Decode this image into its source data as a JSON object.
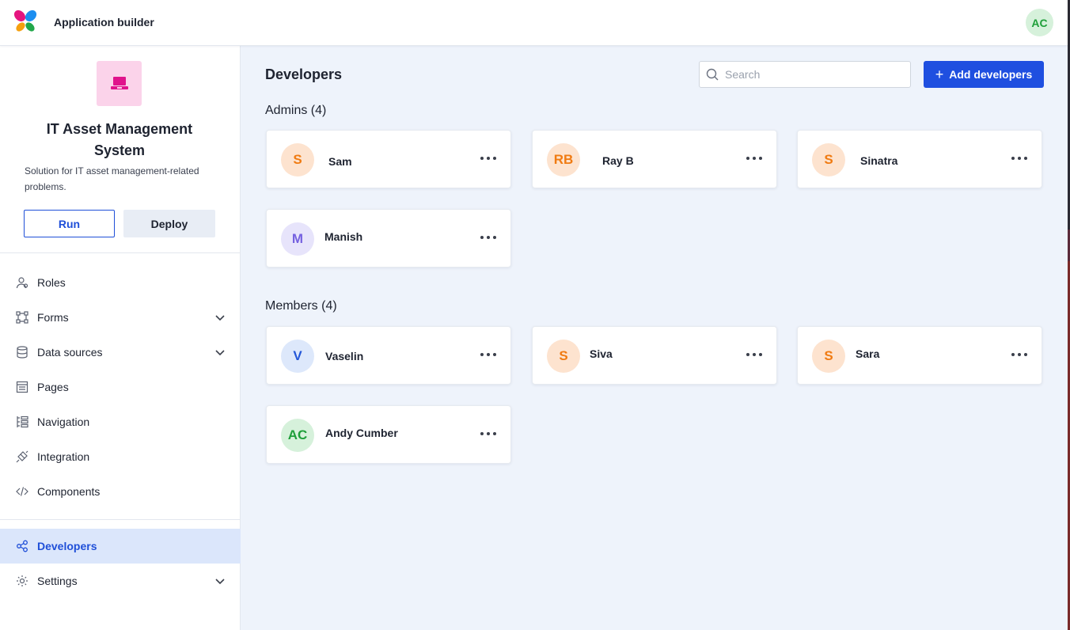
{
  "header": {
    "app_title": "Application builder",
    "user_initials": "AC"
  },
  "sidebar": {
    "app": {
      "name": "IT Asset Management System",
      "description": "Solution for IT asset management-related problems.",
      "icon": "laptop-icon",
      "icon_color": "#e0138c"
    },
    "run_label": "Run",
    "deploy_label": "Deploy",
    "items": [
      {
        "label": "Roles",
        "icon": "roles-icon",
        "expandable": false
      },
      {
        "label": "Forms",
        "icon": "forms-icon",
        "expandable": true
      },
      {
        "label": "Data sources",
        "icon": "database-icon",
        "expandable": true
      },
      {
        "label": "Pages",
        "icon": "pages-icon",
        "expandable": false
      },
      {
        "label": "Navigation",
        "icon": "navigation-icon",
        "expandable": false
      },
      {
        "label": "Integration",
        "icon": "integration-icon",
        "expandable": false
      },
      {
        "label": "Components",
        "icon": "code-icon",
        "expandable": false
      }
    ],
    "bottom_items": [
      {
        "label": "Developers",
        "icon": "share-icon",
        "active": true,
        "expandable": false
      },
      {
        "label": "Settings",
        "icon": "gear-icon",
        "active": false,
        "expandable": true
      }
    ]
  },
  "main": {
    "title": "Developers",
    "search_placeholder": "Search",
    "search_value": "",
    "add_button_label": "Add developers",
    "admins": {
      "title": "Admins (4)",
      "people": [
        {
          "initials": "S",
          "name": "Sam",
          "color": "orange"
        },
        {
          "initials": "RB",
          "name": "Ray B",
          "color": "orange"
        },
        {
          "initials": "S",
          "name": "Sinatra",
          "color": "orange"
        },
        {
          "initials": "M",
          "name": "Manish",
          "color": "purple"
        }
      ]
    },
    "members": {
      "title": "Members (4)",
      "people": [
        {
          "initials": "V",
          "name": "Vaselin",
          "color": "blue"
        },
        {
          "initials": "S",
          "name": "Siva",
          "color": "orange"
        },
        {
          "initials": "S",
          "name": "Sara",
          "color": "orange"
        },
        {
          "initials": "AC",
          "name": "Andy Cumber",
          "color": "green"
        }
      ]
    }
  },
  "colors": {
    "accent": "#1f4fe0",
    "active_nav_bg": "#dbe6fb",
    "canvas_bg": "#eef3fb"
  }
}
